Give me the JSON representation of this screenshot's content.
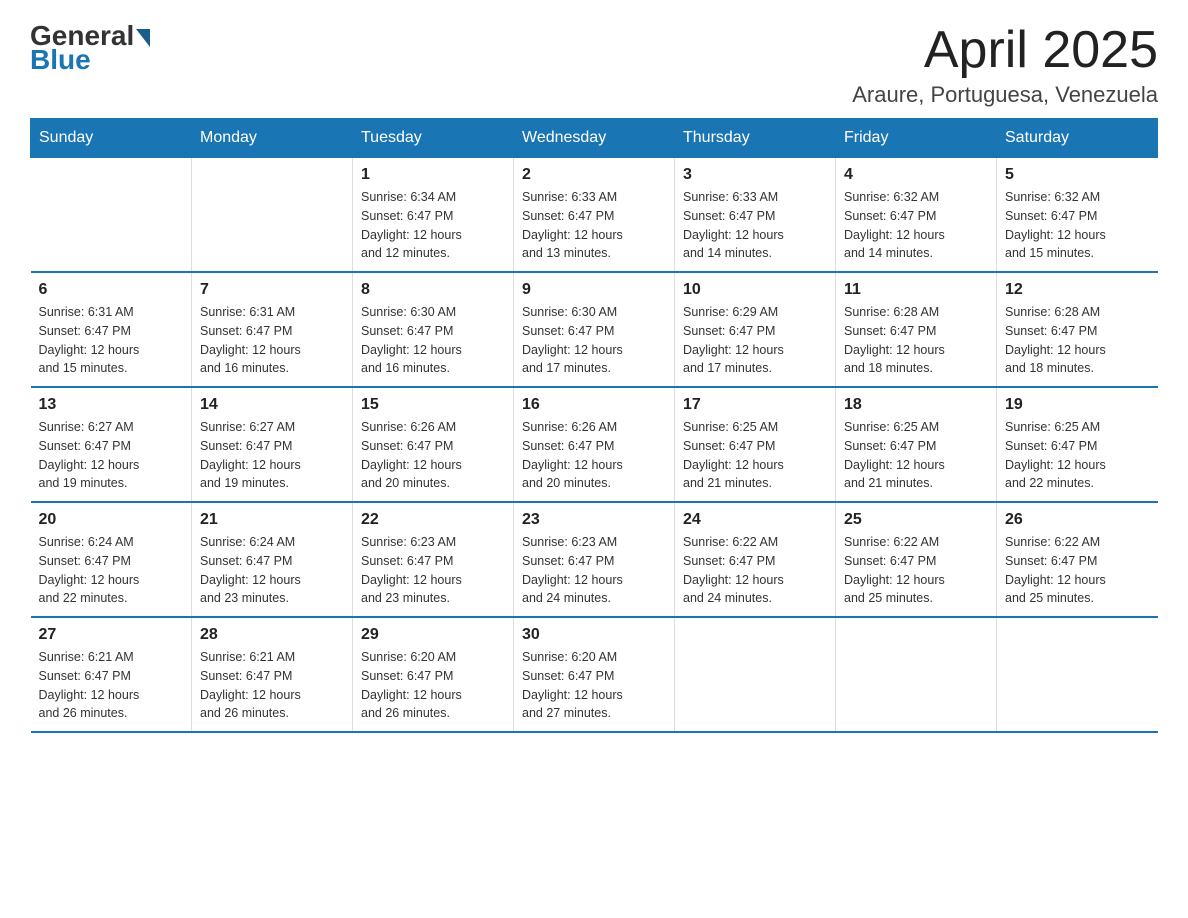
{
  "header": {
    "logo_general": "General",
    "logo_blue": "Blue",
    "month_title": "April 2025",
    "location": "Araure, Portuguesa, Venezuela"
  },
  "calendar": {
    "days_of_week": [
      "Sunday",
      "Monday",
      "Tuesday",
      "Wednesday",
      "Thursday",
      "Friday",
      "Saturday"
    ],
    "rows": [
      [
        {
          "day": "",
          "info": ""
        },
        {
          "day": "",
          "info": ""
        },
        {
          "day": "1",
          "info": "Sunrise: 6:34 AM\nSunset: 6:47 PM\nDaylight: 12 hours\nand 12 minutes."
        },
        {
          "day": "2",
          "info": "Sunrise: 6:33 AM\nSunset: 6:47 PM\nDaylight: 12 hours\nand 13 minutes."
        },
        {
          "day": "3",
          "info": "Sunrise: 6:33 AM\nSunset: 6:47 PM\nDaylight: 12 hours\nand 14 minutes."
        },
        {
          "day": "4",
          "info": "Sunrise: 6:32 AM\nSunset: 6:47 PM\nDaylight: 12 hours\nand 14 minutes."
        },
        {
          "day": "5",
          "info": "Sunrise: 6:32 AM\nSunset: 6:47 PM\nDaylight: 12 hours\nand 15 minutes."
        }
      ],
      [
        {
          "day": "6",
          "info": "Sunrise: 6:31 AM\nSunset: 6:47 PM\nDaylight: 12 hours\nand 15 minutes."
        },
        {
          "day": "7",
          "info": "Sunrise: 6:31 AM\nSunset: 6:47 PM\nDaylight: 12 hours\nand 16 minutes."
        },
        {
          "day": "8",
          "info": "Sunrise: 6:30 AM\nSunset: 6:47 PM\nDaylight: 12 hours\nand 16 minutes."
        },
        {
          "day": "9",
          "info": "Sunrise: 6:30 AM\nSunset: 6:47 PM\nDaylight: 12 hours\nand 17 minutes."
        },
        {
          "day": "10",
          "info": "Sunrise: 6:29 AM\nSunset: 6:47 PM\nDaylight: 12 hours\nand 17 minutes."
        },
        {
          "day": "11",
          "info": "Sunrise: 6:28 AM\nSunset: 6:47 PM\nDaylight: 12 hours\nand 18 minutes."
        },
        {
          "day": "12",
          "info": "Sunrise: 6:28 AM\nSunset: 6:47 PM\nDaylight: 12 hours\nand 18 minutes."
        }
      ],
      [
        {
          "day": "13",
          "info": "Sunrise: 6:27 AM\nSunset: 6:47 PM\nDaylight: 12 hours\nand 19 minutes."
        },
        {
          "day": "14",
          "info": "Sunrise: 6:27 AM\nSunset: 6:47 PM\nDaylight: 12 hours\nand 19 minutes."
        },
        {
          "day": "15",
          "info": "Sunrise: 6:26 AM\nSunset: 6:47 PM\nDaylight: 12 hours\nand 20 minutes."
        },
        {
          "day": "16",
          "info": "Sunrise: 6:26 AM\nSunset: 6:47 PM\nDaylight: 12 hours\nand 20 minutes."
        },
        {
          "day": "17",
          "info": "Sunrise: 6:25 AM\nSunset: 6:47 PM\nDaylight: 12 hours\nand 21 minutes."
        },
        {
          "day": "18",
          "info": "Sunrise: 6:25 AM\nSunset: 6:47 PM\nDaylight: 12 hours\nand 21 minutes."
        },
        {
          "day": "19",
          "info": "Sunrise: 6:25 AM\nSunset: 6:47 PM\nDaylight: 12 hours\nand 22 minutes."
        }
      ],
      [
        {
          "day": "20",
          "info": "Sunrise: 6:24 AM\nSunset: 6:47 PM\nDaylight: 12 hours\nand 22 minutes."
        },
        {
          "day": "21",
          "info": "Sunrise: 6:24 AM\nSunset: 6:47 PM\nDaylight: 12 hours\nand 23 minutes."
        },
        {
          "day": "22",
          "info": "Sunrise: 6:23 AM\nSunset: 6:47 PM\nDaylight: 12 hours\nand 23 minutes."
        },
        {
          "day": "23",
          "info": "Sunrise: 6:23 AM\nSunset: 6:47 PM\nDaylight: 12 hours\nand 24 minutes."
        },
        {
          "day": "24",
          "info": "Sunrise: 6:22 AM\nSunset: 6:47 PM\nDaylight: 12 hours\nand 24 minutes."
        },
        {
          "day": "25",
          "info": "Sunrise: 6:22 AM\nSunset: 6:47 PM\nDaylight: 12 hours\nand 25 minutes."
        },
        {
          "day": "26",
          "info": "Sunrise: 6:22 AM\nSunset: 6:47 PM\nDaylight: 12 hours\nand 25 minutes."
        }
      ],
      [
        {
          "day": "27",
          "info": "Sunrise: 6:21 AM\nSunset: 6:47 PM\nDaylight: 12 hours\nand 26 minutes."
        },
        {
          "day": "28",
          "info": "Sunrise: 6:21 AM\nSunset: 6:47 PM\nDaylight: 12 hours\nand 26 minutes."
        },
        {
          "day": "29",
          "info": "Sunrise: 6:20 AM\nSunset: 6:47 PM\nDaylight: 12 hours\nand 26 minutes."
        },
        {
          "day": "30",
          "info": "Sunrise: 6:20 AM\nSunset: 6:47 PM\nDaylight: 12 hours\nand 27 minutes."
        },
        {
          "day": "",
          "info": ""
        },
        {
          "day": "",
          "info": ""
        },
        {
          "day": "",
          "info": ""
        }
      ]
    ]
  }
}
